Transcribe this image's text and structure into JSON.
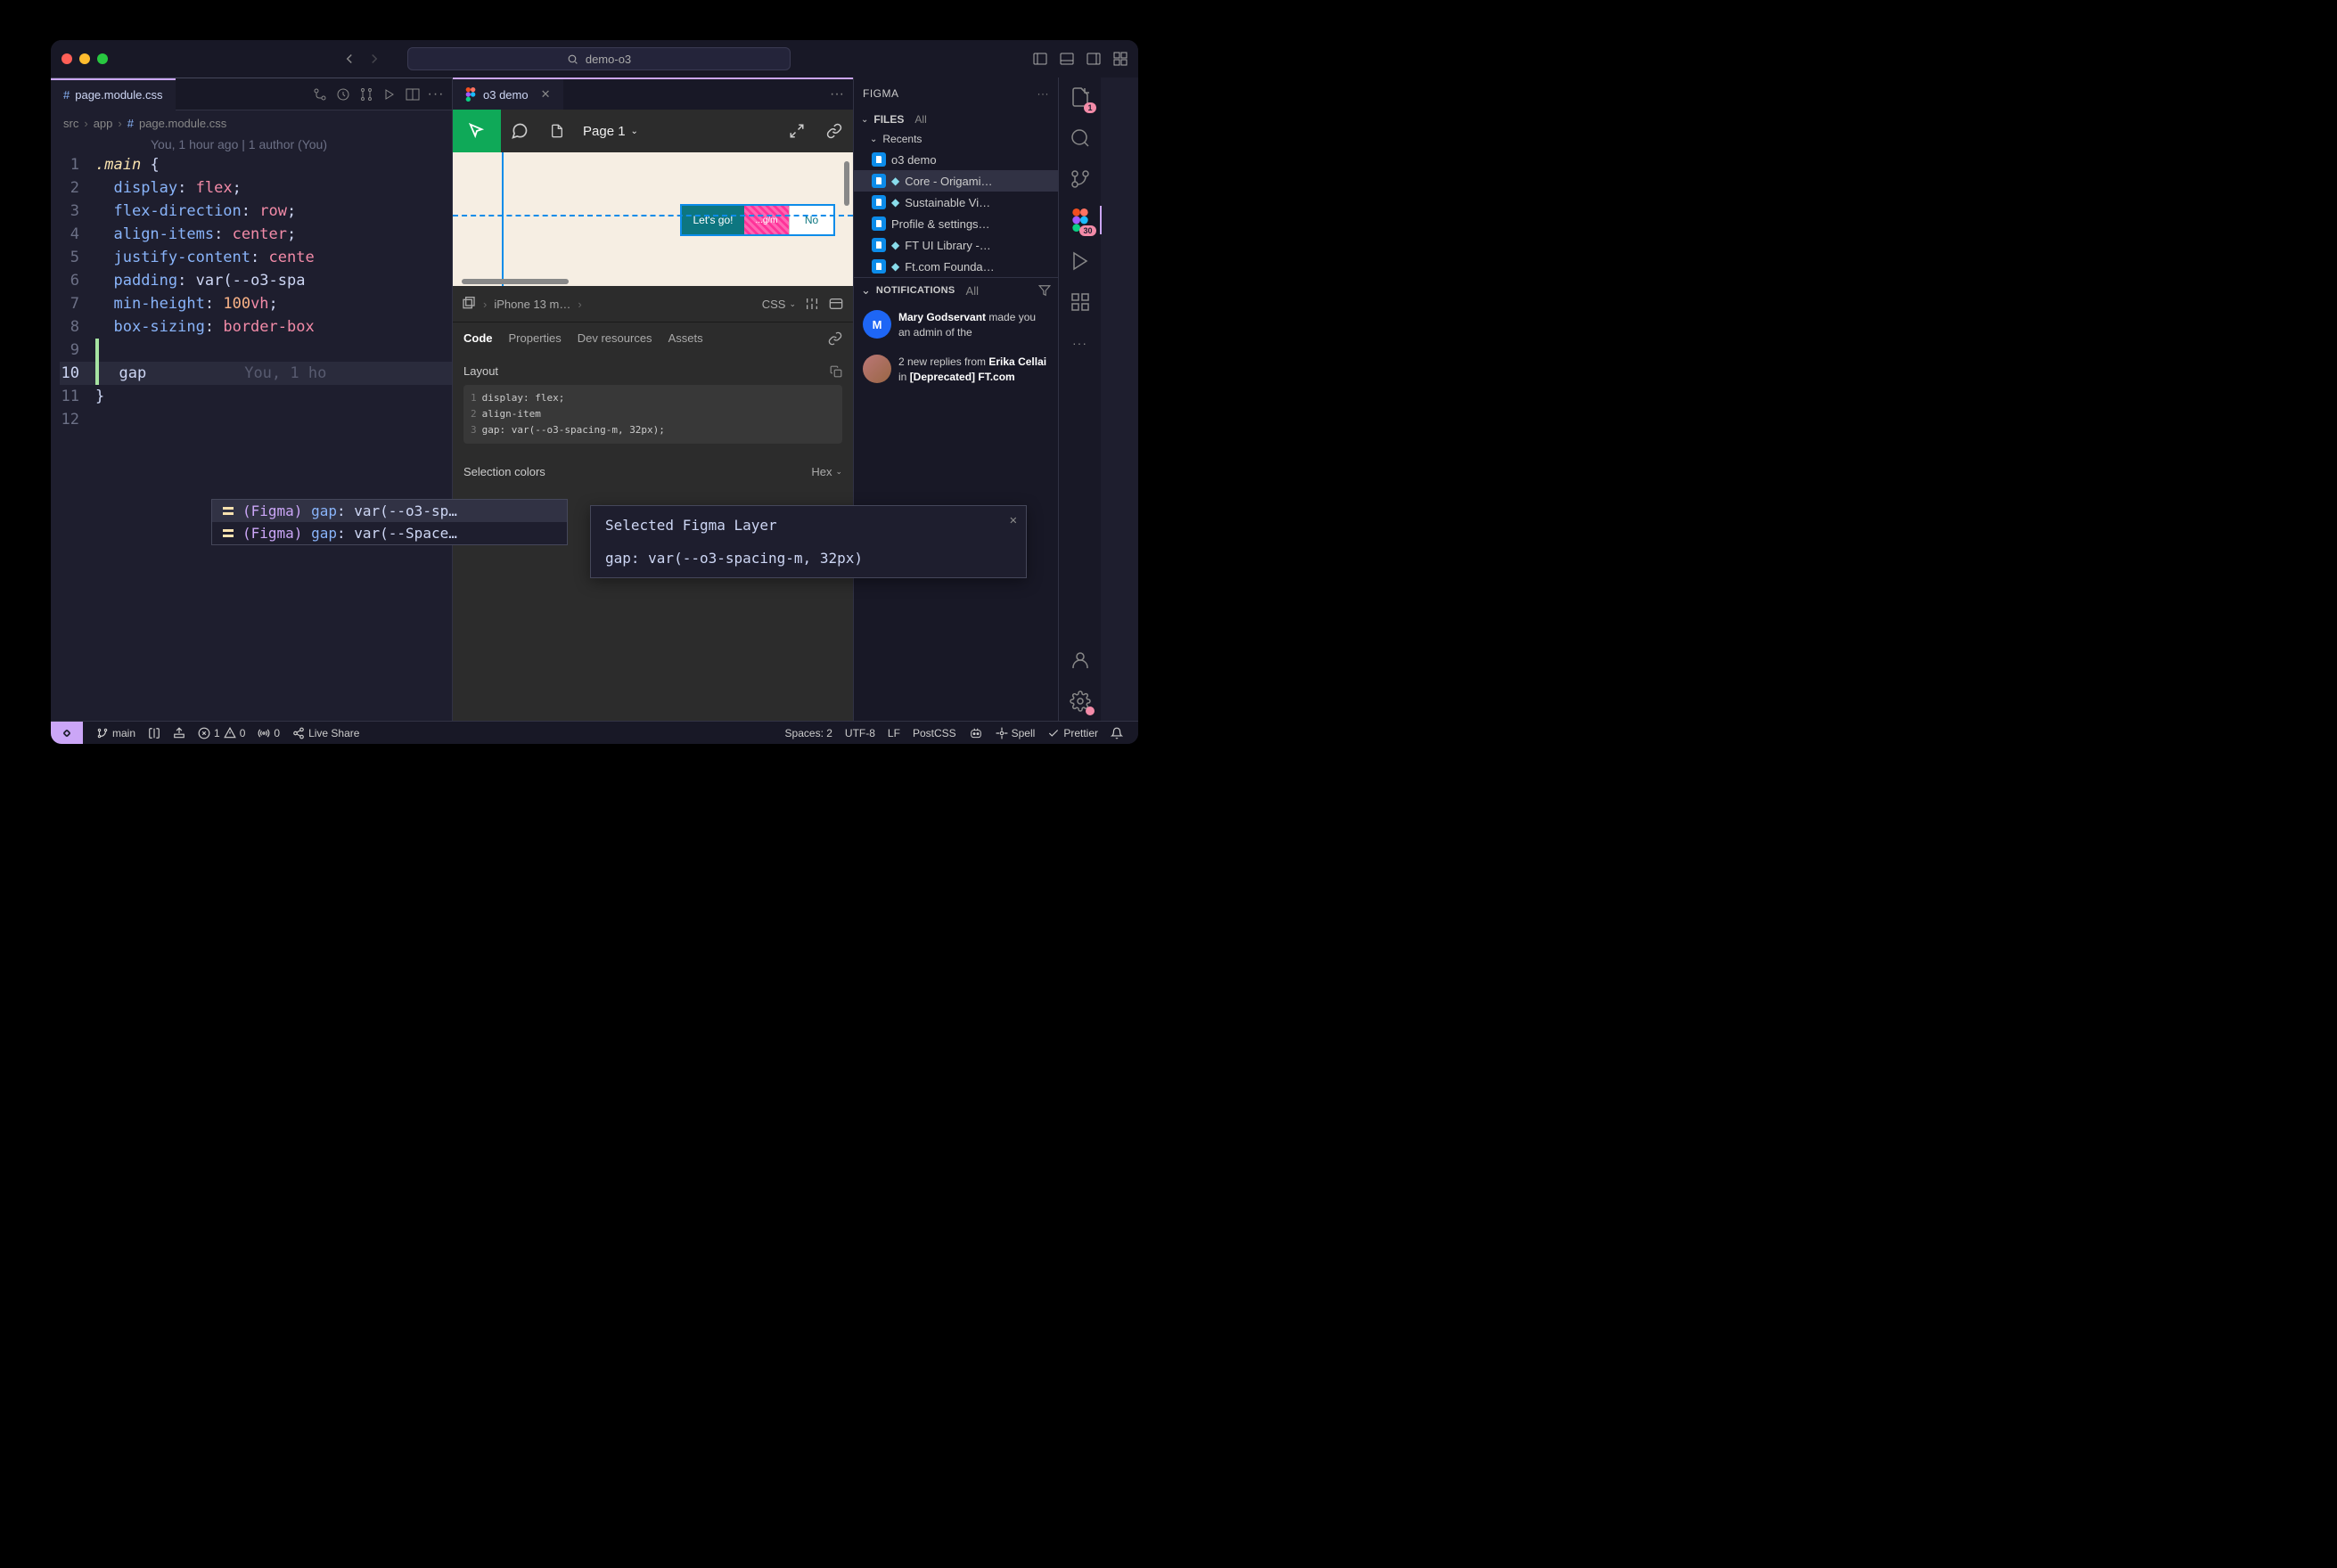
{
  "titlebar": {
    "search": "demo-o3"
  },
  "editor": {
    "tab": "page.module.css",
    "breadcrumb": [
      "src",
      "app",
      "page.module.css"
    ],
    "gitlens": "You, 1 hour ago | 1 author (You)",
    "lines": [
      ".main {",
      "  display: flex;",
      "  flex-direction: row;",
      "  align-items: center;",
      "  justify-content: cente",
      "  padding: var(--o3-spa",
      "  min-height: 100vh;",
      "  box-sizing: border-box",
      "",
      "  gap",
      "}",
      ""
    ],
    "typed": "gap",
    "inline_hint": "You, 1 ho",
    "autocomplete": [
      {
        "label": "(Figma) gap: var(--o3-sp…"
      },
      {
        "label": "(Figma) gap: var(--Space…"
      }
    ],
    "tooltip": {
      "title": "Selected Figma Layer",
      "body": "gap: var(--o3-spacing-m, 32px)"
    }
  },
  "figma": {
    "tab": "o3 demo",
    "page": "Page 1",
    "frame": {
      "btn1": "Let's go!",
      "btn2": "...g/m",
      "btn3": "No"
    },
    "crumb": "iPhone 13 m…",
    "lang": "CSS",
    "tabs": [
      "Code",
      "Properties",
      "Dev resources",
      "Assets"
    ],
    "layout_label": "Layout",
    "code": [
      "display: flex;",
      "align-item",
      "gap: var(--o3-spacing-m, 32px);"
    ],
    "sel_colors": "Selection colors",
    "hex": "Hex"
  },
  "sidebar": {
    "title": "FIGMA",
    "files_label": "FILES",
    "files_all": "All",
    "recents": "Recents",
    "items": [
      {
        "label": "o3 demo",
        "shared": false
      },
      {
        "label": "Core - Origami…",
        "shared": true
      },
      {
        "label": "Sustainable Vi…",
        "shared": true
      },
      {
        "label": "Profile & settings…",
        "shared": false
      },
      {
        "label": "FT UI Library -…",
        "shared": true
      },
      {
        "label": "Ft.com Founda…",
        "shared": true
      }
    ],
    "notif_label": "NOTIFICATIONS",
    "notif_all": "All",
    "notifs": [
      {
        "avatar": "M",
        "html": "<b>Mary Godservant</b> made you an admin of the"
      },
      {
        "avatar": "img",
        "html": "2 new replies from <b>Erika Cellai</b> in <b>[Deprecated] FT.com</b>"
      }
    ]
  },
  "activity": {
    "explorer_badge": "1",
    "figma_badge": "30"
  },
  "statusbar": {
    "branch": "main",
    "errors": "1",
    "warnings": "0",
    "ports": "0",
    "liveshare": "Live Share",
    "spaces": "Spaces: 2",
    "encoding": "UTF-8",
    "eol": "LF",
    "lang": "PostCSS",
    "spell": "Spell",
    "prettier": "Prettier"
  }
}
